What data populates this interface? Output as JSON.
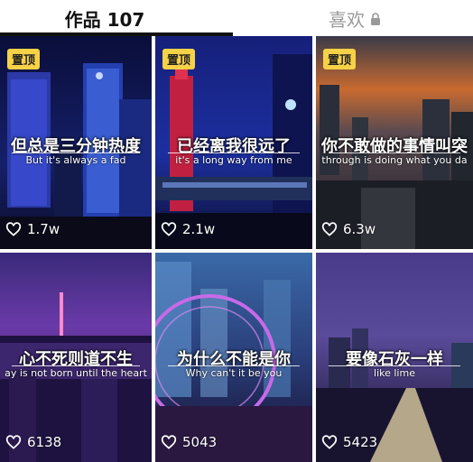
{
  "tabs": {
    "works_label": "作品 107",
    "likes_label": "喜欢"
  },
  "icons": {
    "lock": "lock-icon",
    "heart": "heart-icon"
  },
  "colors": {
    "pin_bg": "#f7d146",
    "active_tab": "#111111",
    "inactive_tab": "#9a9a9a"
  },
  "videos": [
    {
      "pinned": "置顶",
      "title": "但总是三分钟热度",
      "subtitle": "But it's always a fad",
      "likes": "1.7w"
    },
    {
      "pinned": "置顶",
      "title": "已经离我很远了",
      "subtitle": "it's a long way from me",
      "likes": "2.1w"
    },
    {
      "pinned": "置顶",
      "title": "你不敢做的事情叫突",
      "subtitle": "through is doing what you da",
      "likes": "6.3w"
    },
    {
      "title": "心不死则道不生",
      "subtitle": "ay is not born until the heart",
      "likes": "6138"
    },
    {
      "title": "为什么不能是你",
      "subtitle": "Why can't it be you",
      "likes": "5043"
    },
    {
      "title": "要像石灰一样",
      "subtitle": "like lime",
      "likes": "5423"
    }
  ]
}
